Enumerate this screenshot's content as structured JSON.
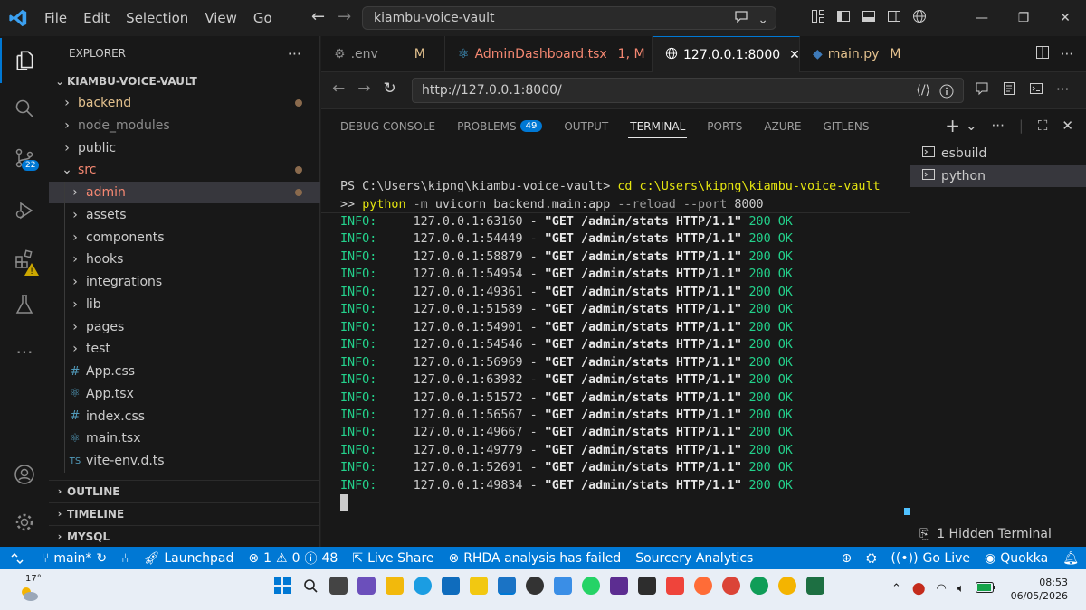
{
  "titlebar": {
    "menu": [
      "File",
      "Edit",
      "Selection",
      "View",
      "Go"
    ],
    "search_text": "kiambu-voice-vault"
  },
  "activity": {
    "scm_badge": "22"
  },
  "sidebar": {
    "title": "EXPLORER",
    "root": "KIAMBU-VOICE-VAULT",
    "items": [
      {
        "label": "backend",
        "indent": 1,
        "type": "folder",
        "open": false,
        "color": "#e2c08d",
        "dot": true
      },
      {
        "label": "node_modules",
        "indent": 1,
        "type": "folder",
        "open": false,
        "color": "#8c8c8c",
        "dot": false
      },
      {
        "label": "public",
        "indent": 1,
        "type": "folder",
        "open": false,
        "color": "#cccccc",
        "dot": false
      },
      {
        "label": "src",
        "indent": 1,
        "type": "folder",
        "open": true,
        "color": "#f48771",
        "dot": true
      },
      {
        "label": "admin",
        "indent": 2,
        "type": "folder",
        "open": false,
        "color": "#f48771",
        "dot": true,
        "selected": true
      },
      {
        "label": "assets",
        "indent": 2,
        "type": "folder",
        "open": false,
        "color": "#cccccc",
        "dot": false
      },
      {
        "label": "components",
        "indent": 2,
        "type": "folder",
        "open": false,
        "color": "#cccccc",
        "dot": false
      },
      {
        "label": "hooks",
        "indent": 2,
        "type": "folder",
        "open": false,
        "color": "#cccccc",
        "dot": false
      },
      {
        "label": "integrations",
        "indent": 2,
        "type": "folder",
        "open": false,
        "color": "#cccccc",
        "dot": false
      },
      {
        "label": "lib",
        "indent": 2,
        "type": "folder",
        "open": false,
        "color": "#cccccc",
        "dot": false
      },
      {
        "label": "pages",
        "indent": 2,
        "type": "folder",
        "open": false,
        "color": "#cccccc",
        "dot": false
      },
      {
        "label": "test",
        "indent": 2,
        "type": "folder",
        "open": false,
        "color": "#cccccc",
        "dot": false
      },
      {
        "label": "App.css",
        "indent": 2,
        "type": "css",
        "color": "#cccccc",
        "dot": false
      },
      {
        "label": "App.tsx",
        "indent": 2,
        "type": "react",
        "color": "#cccccc",
        "dot": false
      },
      {
        "label": "index.css",
        "indent": 2,
        "type": "css",
        "color": "#cccccc",
        "dot": false
      },
      {
        "label": "main.tsx",
        "indent": 2,
        "type": "react",
        "color": "#cccccc",
        "dot": false
      },
      {
        "label": "vite-env.d.ts",
        "indent": 2,
        "type": "ts",
        "color": "#cccccc",
        "dot": false
      }
    ],
    "sections": [
      "OUTLINE",
      "TIMELINE",
      "MYSQL"
    ]
  },
  "tabs": [
    {
      "label": ".env",
      "mod": "M",
      "icon": "gear-icon",
      "color": "#cccccc"
    },
    {
      "label": "AdminDashboard.tsx",
      "mod": "1, M",
      "icon": "react-icon",
      "color": "#f48771"
    },
    {
      "label": "127.0.0.1:8000",
      "mod": "",
      "icon": "globe-icon",
      "color": "#ffffff",
      "active": true
    },
    {
      "label": "main.py",
      "mod": "M",
      "icon": "python-icon",
      "color": "#e2c08d"
    }
  ],
  "browser": {
    "url": "http://127.0.0.1:8000/"
  },
  "panel": {
    "tabs": [
      "DEBUG CONSOLE",
      "PROBLEMS",
      "OUTPUT",
      "TERMINAL",
      "PORTS",
      "AZURE",
      "GITLENS"
    ],
    "problems_count": "49",
    "active_tab": "TERMINAL"
  },
  "terminal": {
    "prompt": "PS C:\\Users\\kipng\\kiambu-voice-vault>",
    "cmd1": "cd c:\\Users\\kipng\\kiambu-voice-vault",
    "cmd2_prefix": ">> ",
    "cmd2_python": "python",
    "cmd2_flag": "-m",
    "cmd2_module": "uvicorn backend.main:app",
    "cmd2_reload": "--reload --port",
    "cmd2_port": "8000",
    "log_level": "INFO:",
    "log_request": "\"GET /admin/stats HTTP/1.1\"",
    "log_status": "200 OK",
    "log_hosts": [
      "127.0.0.1:63160",
      "127.0.0.1:54449",
      "127.0.0.1:58879",
      "127.0.0.1:54954",
      "127.0.0.1:49361",
      "127.0.0.1:51589",
      "127.0.0.1:54901",
      "127.0.0.1:54546",
      "127.0.0.1:56969",
      "127.0.0.1:63982",
      "127.0.0.1:51572",
      "127.0.0.1:56567",
      "127.0.0.1:49667",
      "127.0.0.1:49779",
      "127.0.0.1:52691",
      "127.0.0.1:49834"
    ],
    "sessions": [
      "esbuild",
      "python"
    ],
    "hidden_label": "1 Hidden Terminal"
  },
  "statusbar": {
    "branch": "main*",
    "launchpad": "Launchpad",
    "errors": "1",
    "warnings": "0",
    "info": "48",
    "liveshare": "Live Share",
    "rhda": "RHDA analysis has failed",
    "sourcery": "Sourcery Analytics",
    "golive": "Go Live",
    "quokka": "Quokka"
  },
  "taskbar": {
    "temp": "17°",
    "time": "08:53",
    "date": "06/05/2026"
  }
}
